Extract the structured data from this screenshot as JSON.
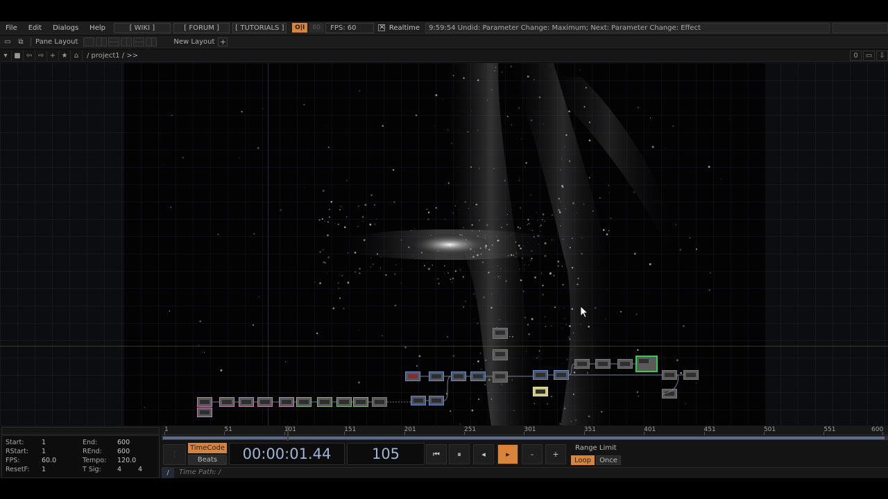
{
  "menu": {
    "items": [
      "File",
      "Edit",
      "Dialogs",
      "Help"
    ],
    "wiki": "[ WIKI ]",
    "forum": "[ FORUM ]",
    "tutorials": "[ TUTORIALS ]",
    "oi": "O|I",
    "sixty": "60",
    "fps": "FPS:  60",
    "realtime": "Realtime",
    "status": "9:59:54 Undid: Parameter Change: Maximum; Next: Parameter Change: Effect"
  },
  "layout": {
    "pane_layout": "Pane Layout",
    "new_layout": "New Layout",
    "plus": "+"
  },
  "pathbar": {
    "path": "/ project1 / >>",
    "counter": "0"
  },
  "info": {
    "start_label": "Start:",
    "start": "1",
    "end_label": "End:",
    "end": "600",
    "rstart_label": "RStart:",
    "rstart": "1",
    "rend_label": "REnd:",
    "rend": "600",
    "fps_label": "FPS:",
    "fps": "60.0",
    "tempo_label": "Tempo:",
    "tempo": "120.0",
    "resetf_label": "ResetF:",
    "resetf": "1",
    "tsig_label": "T Sig:",
    "tsig_a": "4",
    "tsig_b": "4"
  },
  "ruler": {
    "ticks": [
      "1",
      "51",
      "101",
      "151",
      "201",
      "251",
      "301",
      "351",
      "401",
      "451",
      "501",
      "551",
      "600"
    ]
  },
  "transport": {
    "timecode_btn": "TimeCode",
    "beats_btn": "Beats",
    "timecode": "00:00:01.44",
    "frame": "105",
    "range_limit": "Range Limit",
    "loop": "Loop",
    "once": "Once",
    "minus": "-",
    "plus": "+"
  },
  "timepath": {
    "slash": "/",
    "label": "Time Path: /"
  },
  "colors": {
    "accent": "#d9843a",
    "selected_node": "#2fd04a",
    "timecode_text": "#9fb4d6"
  }
}
